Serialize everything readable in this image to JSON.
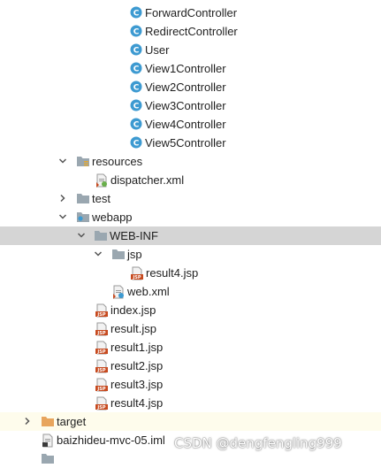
{
  "tree": {
    "controllers": [
      "ForwardController",
      "RedirectController",
      "User",
      "View1Controller",
      "View2Controller",
      "View3Controller",
      "View4Controller",
      "View5Controller"
    ],
    "resources": {
      "label": "resources",
      "file": "dispatcher.xml"
    },
    "test": "test",
    "webapp": {
      "label": "webapp",
      "webinf": {
        "label": "WEB-INF",
        "jsp": {
          "label": "jsp",
          "files": [
            "result4.jsp"
          ]
        },
        "webxml": "web.xml"
      },
      "files": [
        "index.jsp",
        "result.jsp",
        "result1.jsp",
        "result2.jsp",
        "result3.jsp",
        "result4.jsp"
      ]
    },
    "target": "target",
    "iml": "baizhideu-mvc-05.iml"
  },
  "watermark": "CSDN @dengfengling999",
  "colors": {
    "class_icon": "#3d9ad1",
    "folder": "#9aa7b0",
    "target_folder": "#e8a55d",
    "jsp_icon": "#c74a1f",
    "selected_row": "#d5d5d5",
    "highlight_row": "#fefcec"
  }
}
